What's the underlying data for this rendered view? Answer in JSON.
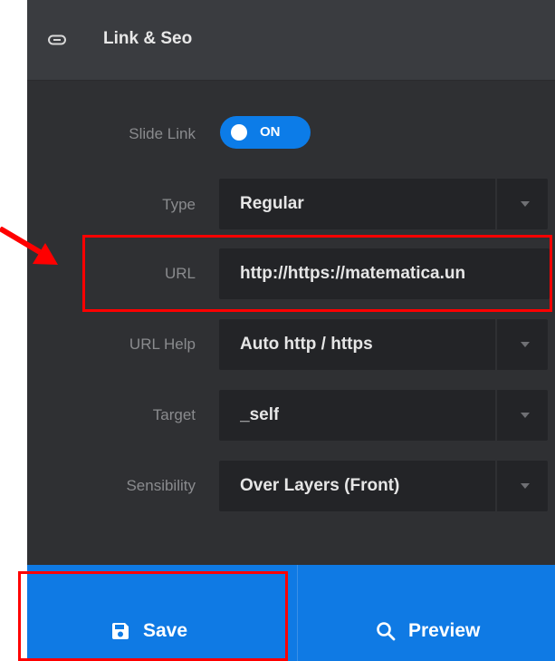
{
  "panel": {
    "title": "Link & Seo",
    "title_icon": "link-icon"
  },
  "fields": {
    "slide_link": {
      "label": "Slide Link",
      "state": "ON",
      "on": true
    },
    "type": {
      "label": "Type",
      "value": "Regular"
    },
    "url": {
      "label": "URL",
      "value": "http://https://matematica.un"
    },
    "url_help": {
      "label": "URL Help",
      "value": "Auto http / https"
    },
    "target": {
      "label": "Target",
      "value": "_self"
    },
    "sensibility": {
      "label": "Sensibility",
      "value": "Over Layers (Front)"
    }
  },
  "footer": {
    "save_label": "Save",
    "save_icon": "floppy-disk-icon",
    "preview_label": "Preview",
    "preview_icon": "magnifier-icon"
  },
  "colors": {
    "panel_bg": "#2f3033",
    "header_bg": "#3a3c40",
    "field_bg": "#232427",
    "accent": "#0f7ae4",
    "annotation": "#ff0000"
  }
}
